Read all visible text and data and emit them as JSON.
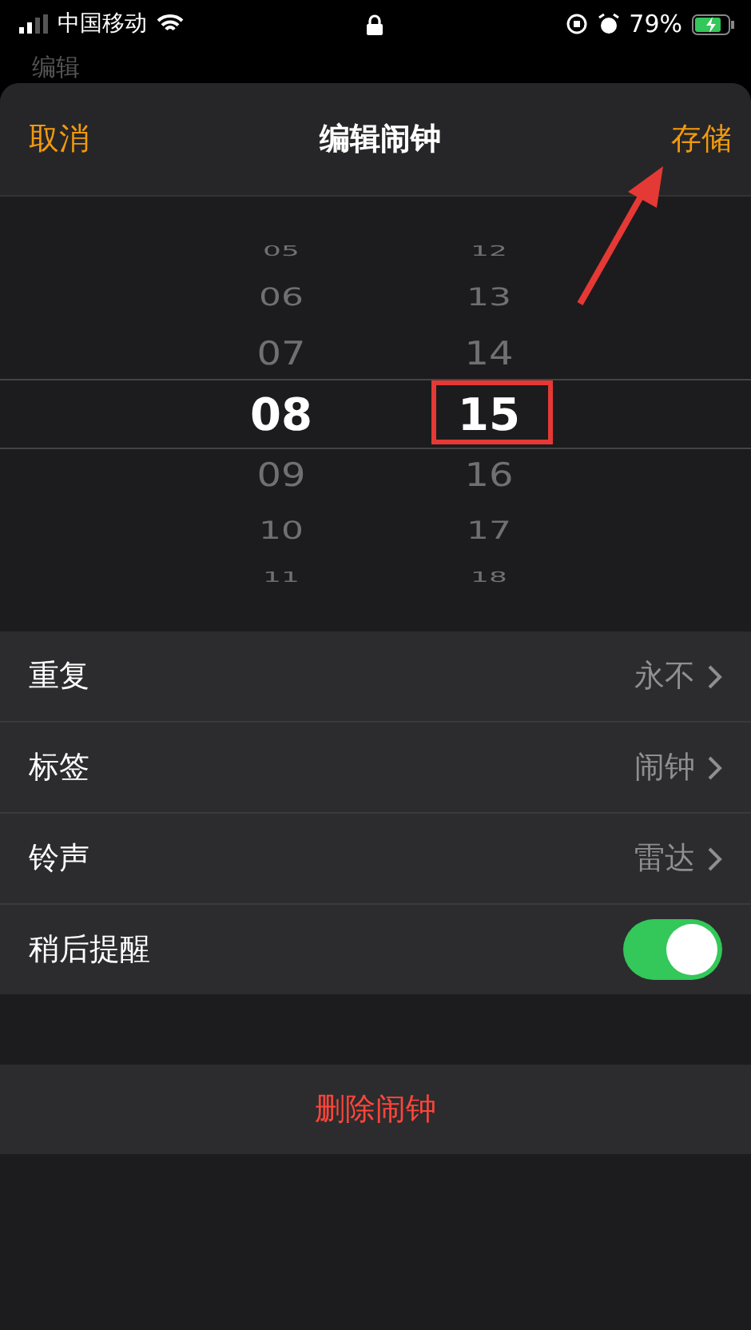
{
  "status_bar": {
    "carrier": "中国移动",
    "battery": "79%"
  },
  "behind_title": "编辑",
  "header": {
    "cancel": "取消",
    "title": "编辑闹钟",
    "save": "存储"
  },
  "picker": {
    "hours": [
      {
        "label": "05",
        "selected": false
      },
      {
        "label": "06",
        "selected": false
      },
      {
        "label": "07",
        "selected": false
      },
      {
        "label": "08",
        "selected": true
      },
      {
        "label": "09",
        "selected": false
      },
      {
        "label": "10",
        "selected": false
      },
      {
        "label": "11",
        "selected": false
      }
    ],
    "minutes": [
      {
        "label": "12",
        "selected": false
      },
      {
        "label": "13",
        "selected": false
      },
      {
        "label": "14",
        "selected": false
      },
      {
        "label": "15",
        "selected": true
      },
      {
        "label": "16",
        "selected": false
      },
      {
        "label": "17",
        "selected": false
      },
      {
        "label": "18",
        "selected": false
      }
    ]
  },
  "settings": [
    {
      "kind": "value",
      "label": "重复",
      "value": "永不"
    },
    {
      "kind": "value",
      "label": "标签",
      "value": "闹钟"
    },
    {
      "kind": "value",
      "label": "铃声",
      "value": "雷达"
    },
    {
      "kind": "toggle",
      "label": "稍后提醒",
      "on": true
    }
  ],
  "delete_button": "删除闹钟"
}
